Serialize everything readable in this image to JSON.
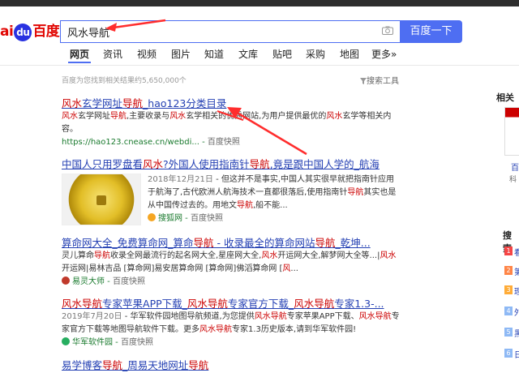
{
  "header": {
    "logo_prefix": "ai",
    "logo_du": "du",
    "logo_suffix": "百度",
    "search_value": "风水导航",
    "search_button": "百度一下"
  },
  "tabs": [
    "网页",
    "资讯",
    "视频",
    "图片",
    "知道",
    "文库",
    "贴吧",
    "采购",
    "地图",
    "更多»"
  ],
  "result_count": "百度为您找到相关结果约5,650,000个",
  "search_tools": "搜索工具",
  "results": [
    {
      "title": "风水玄学网址导航_hao123分类目录",
      "abstract": "风水玄学网址导航,主要收录与风水玄学相关的优秀网站,为用户提供最优的风水玄学等相关内容。",
      "url": "https://hao123.cnease.cn/webdi...",
      "snapshot": "百度快照"
    },
    {
      "title": "中国人只用罗盘看风水?外国人使用指南针导航,竟是跟中国人学的_航海",
      "date": "2018年12月21日",
      "abstract": "- 但这并不是事实,中国人其实很早就把指南针应用于航海了,古代欧洲人航海技术一直都很落后,使用指南针导航其实也是从中国传过去的。用地文导航,船不能...",
      "source": "搜狐网",
      "snapshot": "百度快照"
    },
    {
      "title": "算命网大全_免费算命网_算命导航 - 收录最全的算命网站导航_乾坤...",
      "abstract": "灵儿算命导航收录全网最流行的起名网大全,星座网大全,风水开运网大全,解梦网大全等...|风水开运网|易林吉品 [算命网]易安居算命网 [算命网]佛滔算命网 [风...",
      "source": "易灵大师",
      "snapshot": "百度快照"
    },
    {
      "title": "风水导航专家苹果APP下载_风水导航专家官方下载_风水导航专家1.3-...",
      "date": "2019年7月20日",
      "abstract": "- 华军软件园地图导航频道,为您提供风水导航专家苹果APP下载、风水导航专家官方下载等地图导航软件下载。更多风水导航专家1.3历史版本,请到华军软件园!",
      "source": "华军软件园",
      "snapshot": "百度快照"
    },
    {
      "title": "易学博客导航_周易天地网址导航",
      "abstract": "",
      "source": "",
      "snapshot": ""
    }
  ],
  "right_col": {
    "title": "相关",
    "label1": "百",
    "label2": "科",
    "hot_title": "搜索",
    "ranks": [
      {
        "n": "1",
        "text": "看",
        "color": "#f54545"
      },
      {
        "n": "2",
        "text": "第",
        "color": "#ff8547"
      },
      {
        "n": "3",
        "text": "理",
        "color": "#ffac38"
      },
      {
        "n": "4",
        "text": "外",
        "color": "#8eb9f5"
      },
      {
        "n": "5",
        "text": "黑",
        "color": "#8eb9f5"
      },
      {
        "n": "6",
        "text": "日",
        "color": "#8eb9f5"
      }
    ]
  }
}
